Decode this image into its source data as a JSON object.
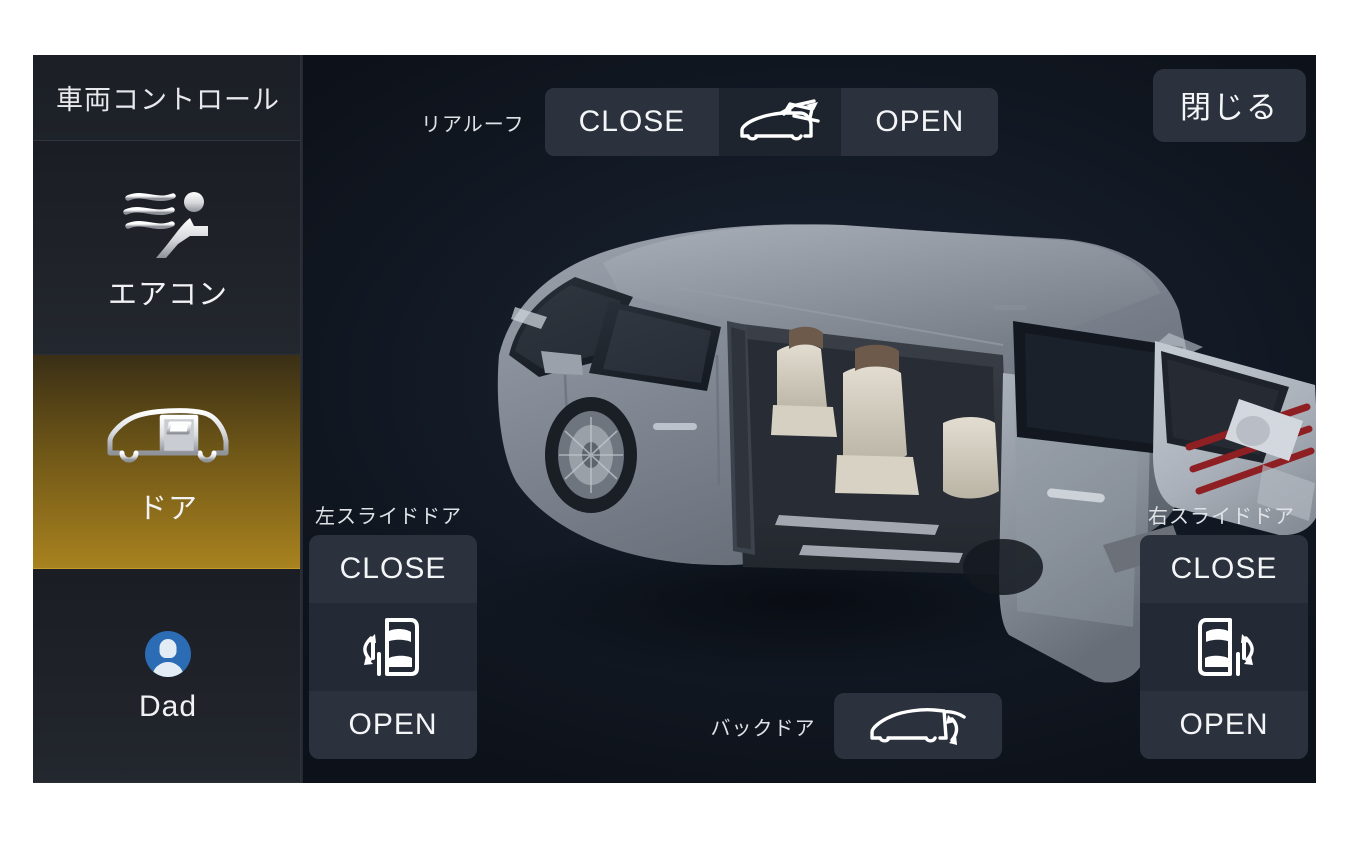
{
  "sidebar": {
    "header": "車両コントロール",
    "items": [
      {
        "label": "エアコン",
        "icon": "airflow-seat-icon",
        "selected": false
      },
      {
        "label": "ドア",
        "icon": "car-door-icon",
        "selected": true
      },
      {
        "label": "Dad",
        "icon": "user-avatar-icon",
        "selected": false
      }
    ]
  },
  "toolbar": {
    "close_label": "閉じる"
  },
  "controls": {
    "rear_roof": {
      "label": "リアルーフ",
      "close_label": "CLOSE",
      "open_label": "OPEN",
      "icon": "sunroof-slide-icon"
    },
    "left_slide_door": {
      "label": "左スライドドア",
      "close_label": "CLOSE",
      "open_label": "OPEN",
      "icon": "slide-door-left-icon"
    },
    "right_slide_door": {
      "label": "右スライドドア",
      "close_label": "CLOSE",
      "open_label": "OPEN",
      "icon": "slide-door-right-icon"
    },
    "back_door": {
      "label": "バックドア",
      "icon": "back-hatch-icon"
    }
  },
  "colors": {
    "accent_selected": "#a8821f",
    "panel_background": "#11161f",
    "sidebar_background": "#1d2128",
    "button_background": "#2b323e",
    "text_primary": "#f4f5f7",
    "avatar_blue": "#2b6cb5",
    "taillight_red": "#8e1f22"
  }
}
